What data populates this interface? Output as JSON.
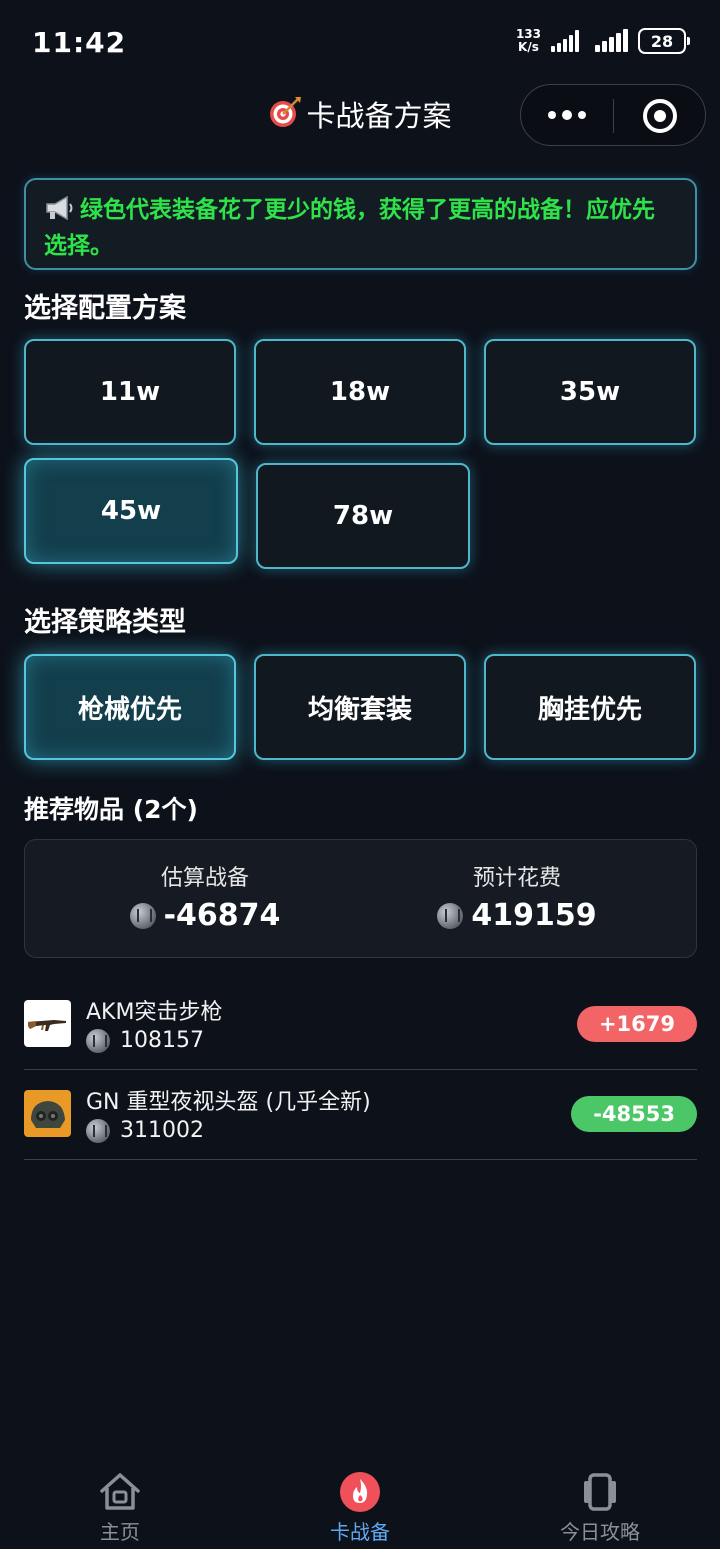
{
  "status": {
    "time": "11:42",
    "speed_top": "133",
    "speed_bottom": "K/s",
    "battery": "28"
  },
  "header": {
    "title": "卡战备方案"
  },
  "notice": {
    "text": "绿色代表装备花了更少的钱，获得了更高的战备！应优先选择。",
    "color": "#2ee24a"
  },
  "config": {
    "title": "选择配置方案",
    "options": [
      "11w",
      "18w",
      "35w",
      "45w",
      "78w"
    ],
    "selected": "45w"
  },
  "strategy": {
    "title": "选择策略类型",
    "options": [
      "枪械优先",
      "均衡套装",
      "胸挂优先"
    ],
    "selected": "枪械优先"
  },
  "recommend": {
    "title": "推荐物品 (2个)",
    "est_label": "估算战备",
    "est_value": "-46874",
    "cost_label": "预计花费",
    "cost_value": "419159",
    "items": [
      {
        "name": "AKM突击步枪",
        "price": "108157",
        "diff": "+1679",
        "diff_color": "#f26466",
        "thumb": "rifle-image"
      },
      {
        "name": "GN 重型夜视头盔 (几乎全新)",
        "price": "311002",
        "diff": "-48553",
        "diff_color": "#4cc767",
        "thumb": "helmet-image"
      }
    ]
  },
  "tabs": [
    {
      "label": "主页",
      "icon": "home-icon"
    },
    {
      "label": "卡战备",
      "icon": "fire-icon",
      "active": true
    },
    {
      "label": "今日攻略",
      "icon": "guide-icon"
    }
  ],
  "colors": {
    "accent": "#4fb6cc",
    "background": "#0d111a",
    "tab_active": "#5fa8f0"
  }
}
